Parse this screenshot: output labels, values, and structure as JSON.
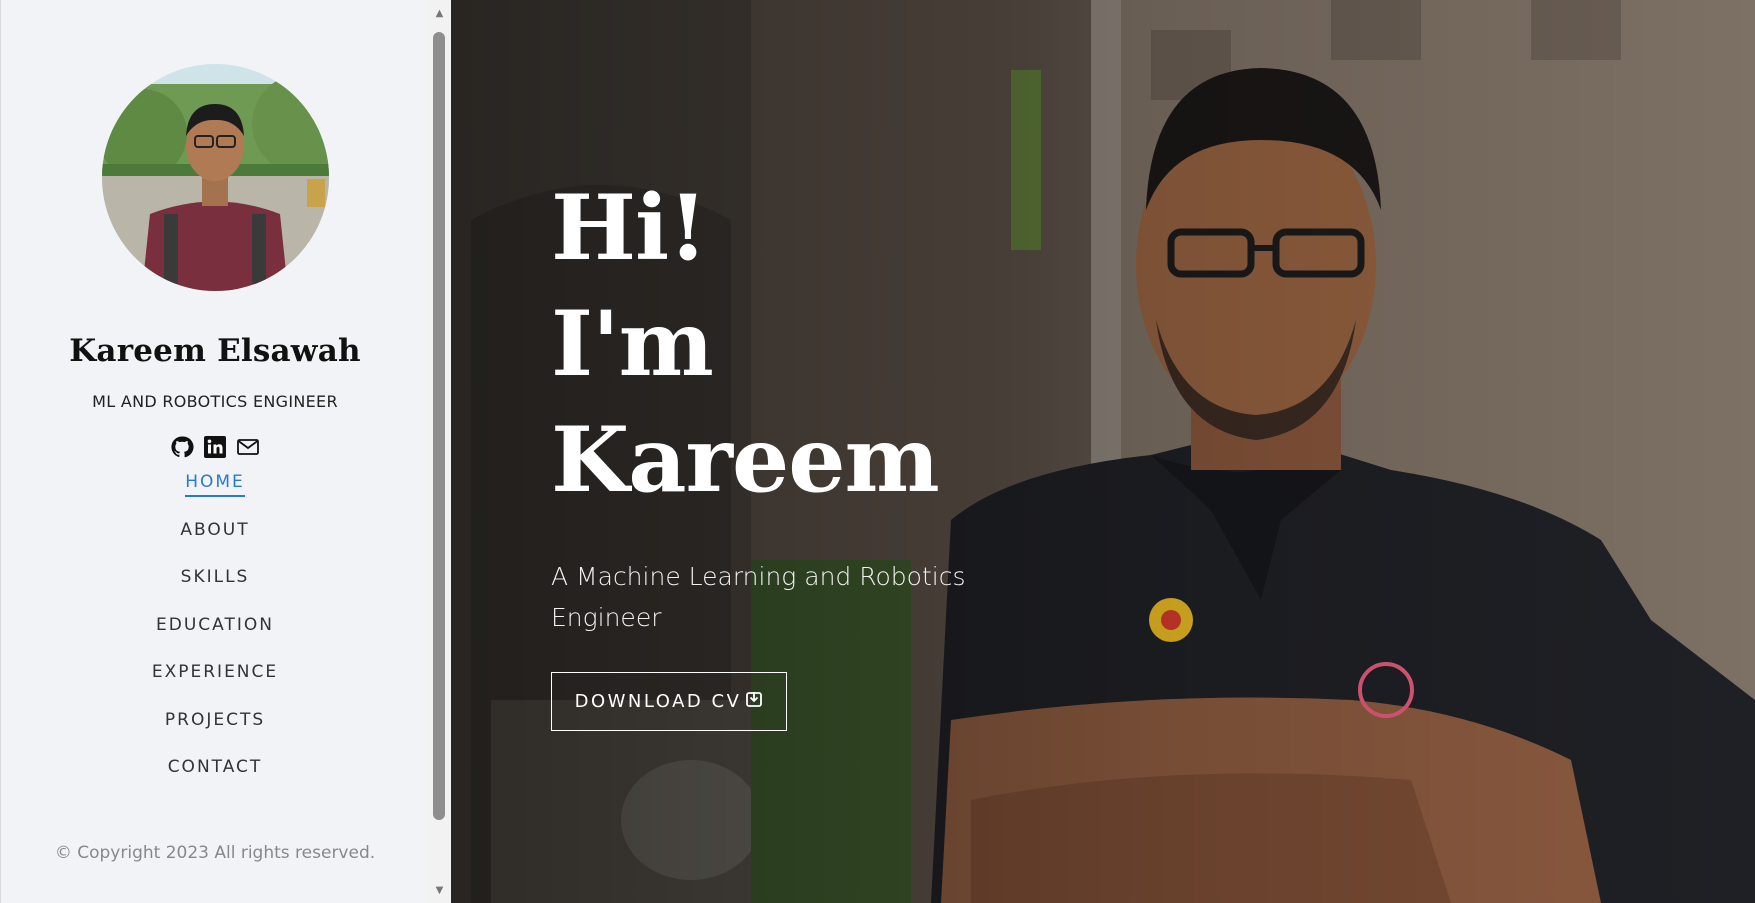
{
  "profile": {
    "name": "Kareem Elsawah",
    "role": "ML AND ROBOTICS ENGINEER",
    "avatar_icon": "profile-photo"
  },
  "socials": [
    {
      "name": "github-icon",
      "label": "GitHub"
    },
    {
      "name": "linkedin-icon",
      "label": "LinkedIn"
    },
    {
      "name": "mail-icon",
      "label": "Email"
    }
  ],
  "nav": {
    "items": [
      {
        "label": "HOME",
        "active": true
      },
      {
        "label": "ABOUT",
        "active": false
      },
      {
        "label": "SKILLS",
        "active": false
      },
      {
        "label": "EDUCATION",
        "active": false
      },
      {
        "label": "EXPERIENCE",
        "active": false
      },
      {
        "label": "PROJECTS",
        "active": false
      },
      {
        "label": "CONTACT",
        "active": false
      }
    ]
  },
  "footer": {
    "copyright": "© Copyright 2023 All rights reserved."
  },
  "hero": {
    "line1": "Hi!",
    "line2": "I'm",
    "line3": "Kareem",
    "tagline": "A Machine Learning and Robotics Engineer",
    "cv_button": "DOWNLOAD CV"
  },
  "colors": {
    "sidebar_bg": "#f2f3f7",
    "accent": "#2a78d6",
    "text": "#333333"
  }
}
